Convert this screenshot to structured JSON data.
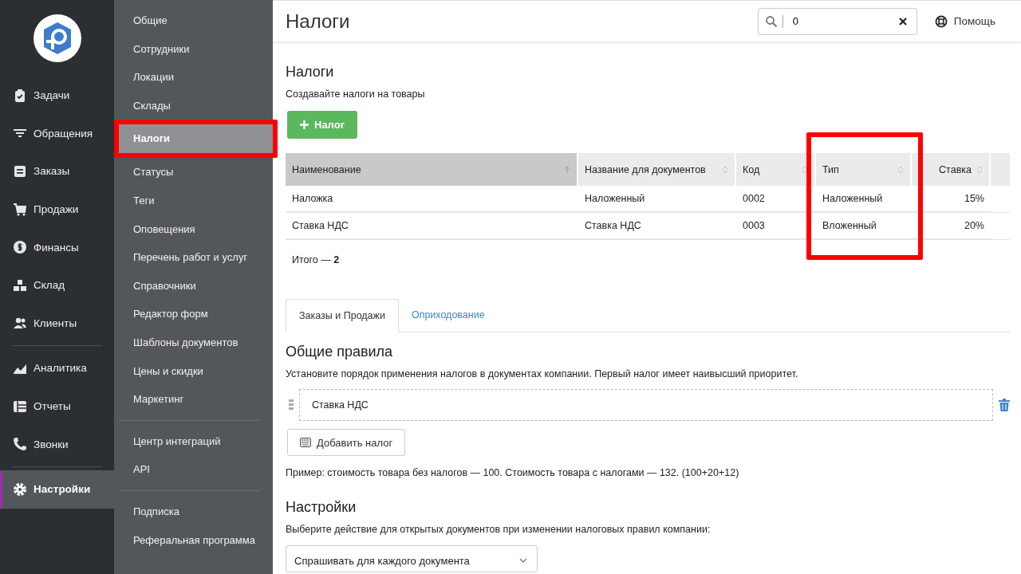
{
  "main_nav": {
    "groups": [
      [
        {
          "label": "Задачи",
          "kind": "tasks",
          "selected": false
        },
        {
          "label": "Обращения",
          "kind": "filter",
          "selected": false
        },
        {
          "label": "Заказы",
          "kind": "orders",
          "selected": false
        },
        {
          "label": "Продажи",
          "kind": "cart",
          "selected": false
        },
        {
          "label": "Финансы",
          "kind": "dollar",
          "selected": false
        },
        {
          "label": "Склад",
          "kind": "boxes",
          "selected": false
        },
        {
          "label": "Клиенты",
          "kind": "people",
          "selected": false
        }
      ],
      [
        {
          "label": "Аналитика",
          "kind": "chart",
          "selected": false
        },
        {
          "label": "Отчеты",
          "kind": "table",
          "selected": false
        },
        {
          "label": "Звонки",
          "kind": "phone",
          "selected": false
        }
      ],
      [
        {
          "label": "Настройки",
          "kind": "gear",
          "selected": true
        }
      ]
    ]
  },
  "settings_nav": {
    "groups": [
      [
        {
          "label": "Общие",
          "selected": false,
          "highlighted": false
        },
        {
          "label": "Сотрудники",
          "selected": false,
          "highlighted": false
        },
        {
          "label": "Локации",
          "selected": false,
          "highlighted": false
        },
        {
          "label": "Склады",
          "selected": false,
          "highlighted": false
        },
        {
          "label": "Налоги",
          "selected": true,
          "highlighted": true
        },
        {
          "label": "Статусы",
          "selected": false,
          "highlighted": false
        },
        {
          "label": "Теги",
          "selected": false,
          "highlighted": false
        },
        {
          "label": "Оповещения",
          "selected": false,
          "highlighted": false
        },
        {
          "label": "Перечень работ и услуг",
          "selected": false,
          "highlighted": false
        },
        {
          "label": "Справочники",
          "selected": false,
          "highlighted": false
        },
        {
          "label": "Редактор форм",
          "selected": false,
          "highlighted": false
        },
        {
          "label": "Шаблоны документов",
          "selected": false,
          "highlighted": false
        },
        {
          "label": "Цены и скидки",
          "selected": false,
          "highlighted": false
        },
        {
          "label": "Маркетинг",
          "selected": false,
          "highlighted": false
        }
      ],
      [
        {
          "label": "Центр интеграций",
          "selected": false,
          "highlighted": false
        },
        {
          "label": "API",
          "selected": false,
          "highlighted": false
        }
      ],
      [
        {
          "label": "Подписка",
          "selected": false,
          "highlighted": false
        },
        {
          "label": "Реферальная программа",
          "selected": false,
          "highlighted": false
        }
      ]
    ]
  },
  "header": {
    "title": "Налоги",
    "search": {
      "value": "0"
    },
    "help": "Помощь"
  },
  "taxes": {
    "title": "Налоги",
    "subtitle": "Создавайте налоги на товары",
    "add_button": "Налог",
    "table": {
      "columns": [
        {
          "label": "Наименование",
          "sorted": true,
          "highlighted": false
        },
        {
          "label": "Название для документов",
          "sorted": false,
          "highlighted": false
        },
        {
          "label": "Код",
          "sorted": false,
          "highlighted": false
        },
        {
          "label": "Тип",
          "sorted": false,
          "highlighted": true
        },
        {
          "label": "Ставка",
          "sorted": false,
          "highlighted": false
        }
      ],
      "rows": [
        [
          "Наложка",
          "Наложенный",
          "0002",
          "Наложенный",
          "15%"
        ],
        [
          "Ставка НДС",
          "Ставка НДС",
          "0003",
          "Вложенный",
          "20%"
        ]
      ]
    },
    "total_label": "Итого —",
    "total": "2"
  },
  "tabs": [
    {
      "label": "Заказы и Продажи",
      "selected": true
    },
    {
      "label": "Оприходование",
      "selected": false
    }
  ],
  "rules": {
    "title": "Общие правила",
    "description": "Установите порядок применения налогов в документах компании. Первый налог имеет наивысший приоритет.",
    "items": [
      "Ставка НДС"
    ],
    "add_button": "Добавить налог",
    "example": "Пример: стоимость товара без налогов — 100. Стоимость товара с налогами — 132. (100+20+12)"
  },
  "settings": {
    "title": "Настройки",
    "description": "Выберите действие для открытых документов при изменении налоговых правил компании:",
    "select": "Спрашивать для каждого документа"
  }
}
